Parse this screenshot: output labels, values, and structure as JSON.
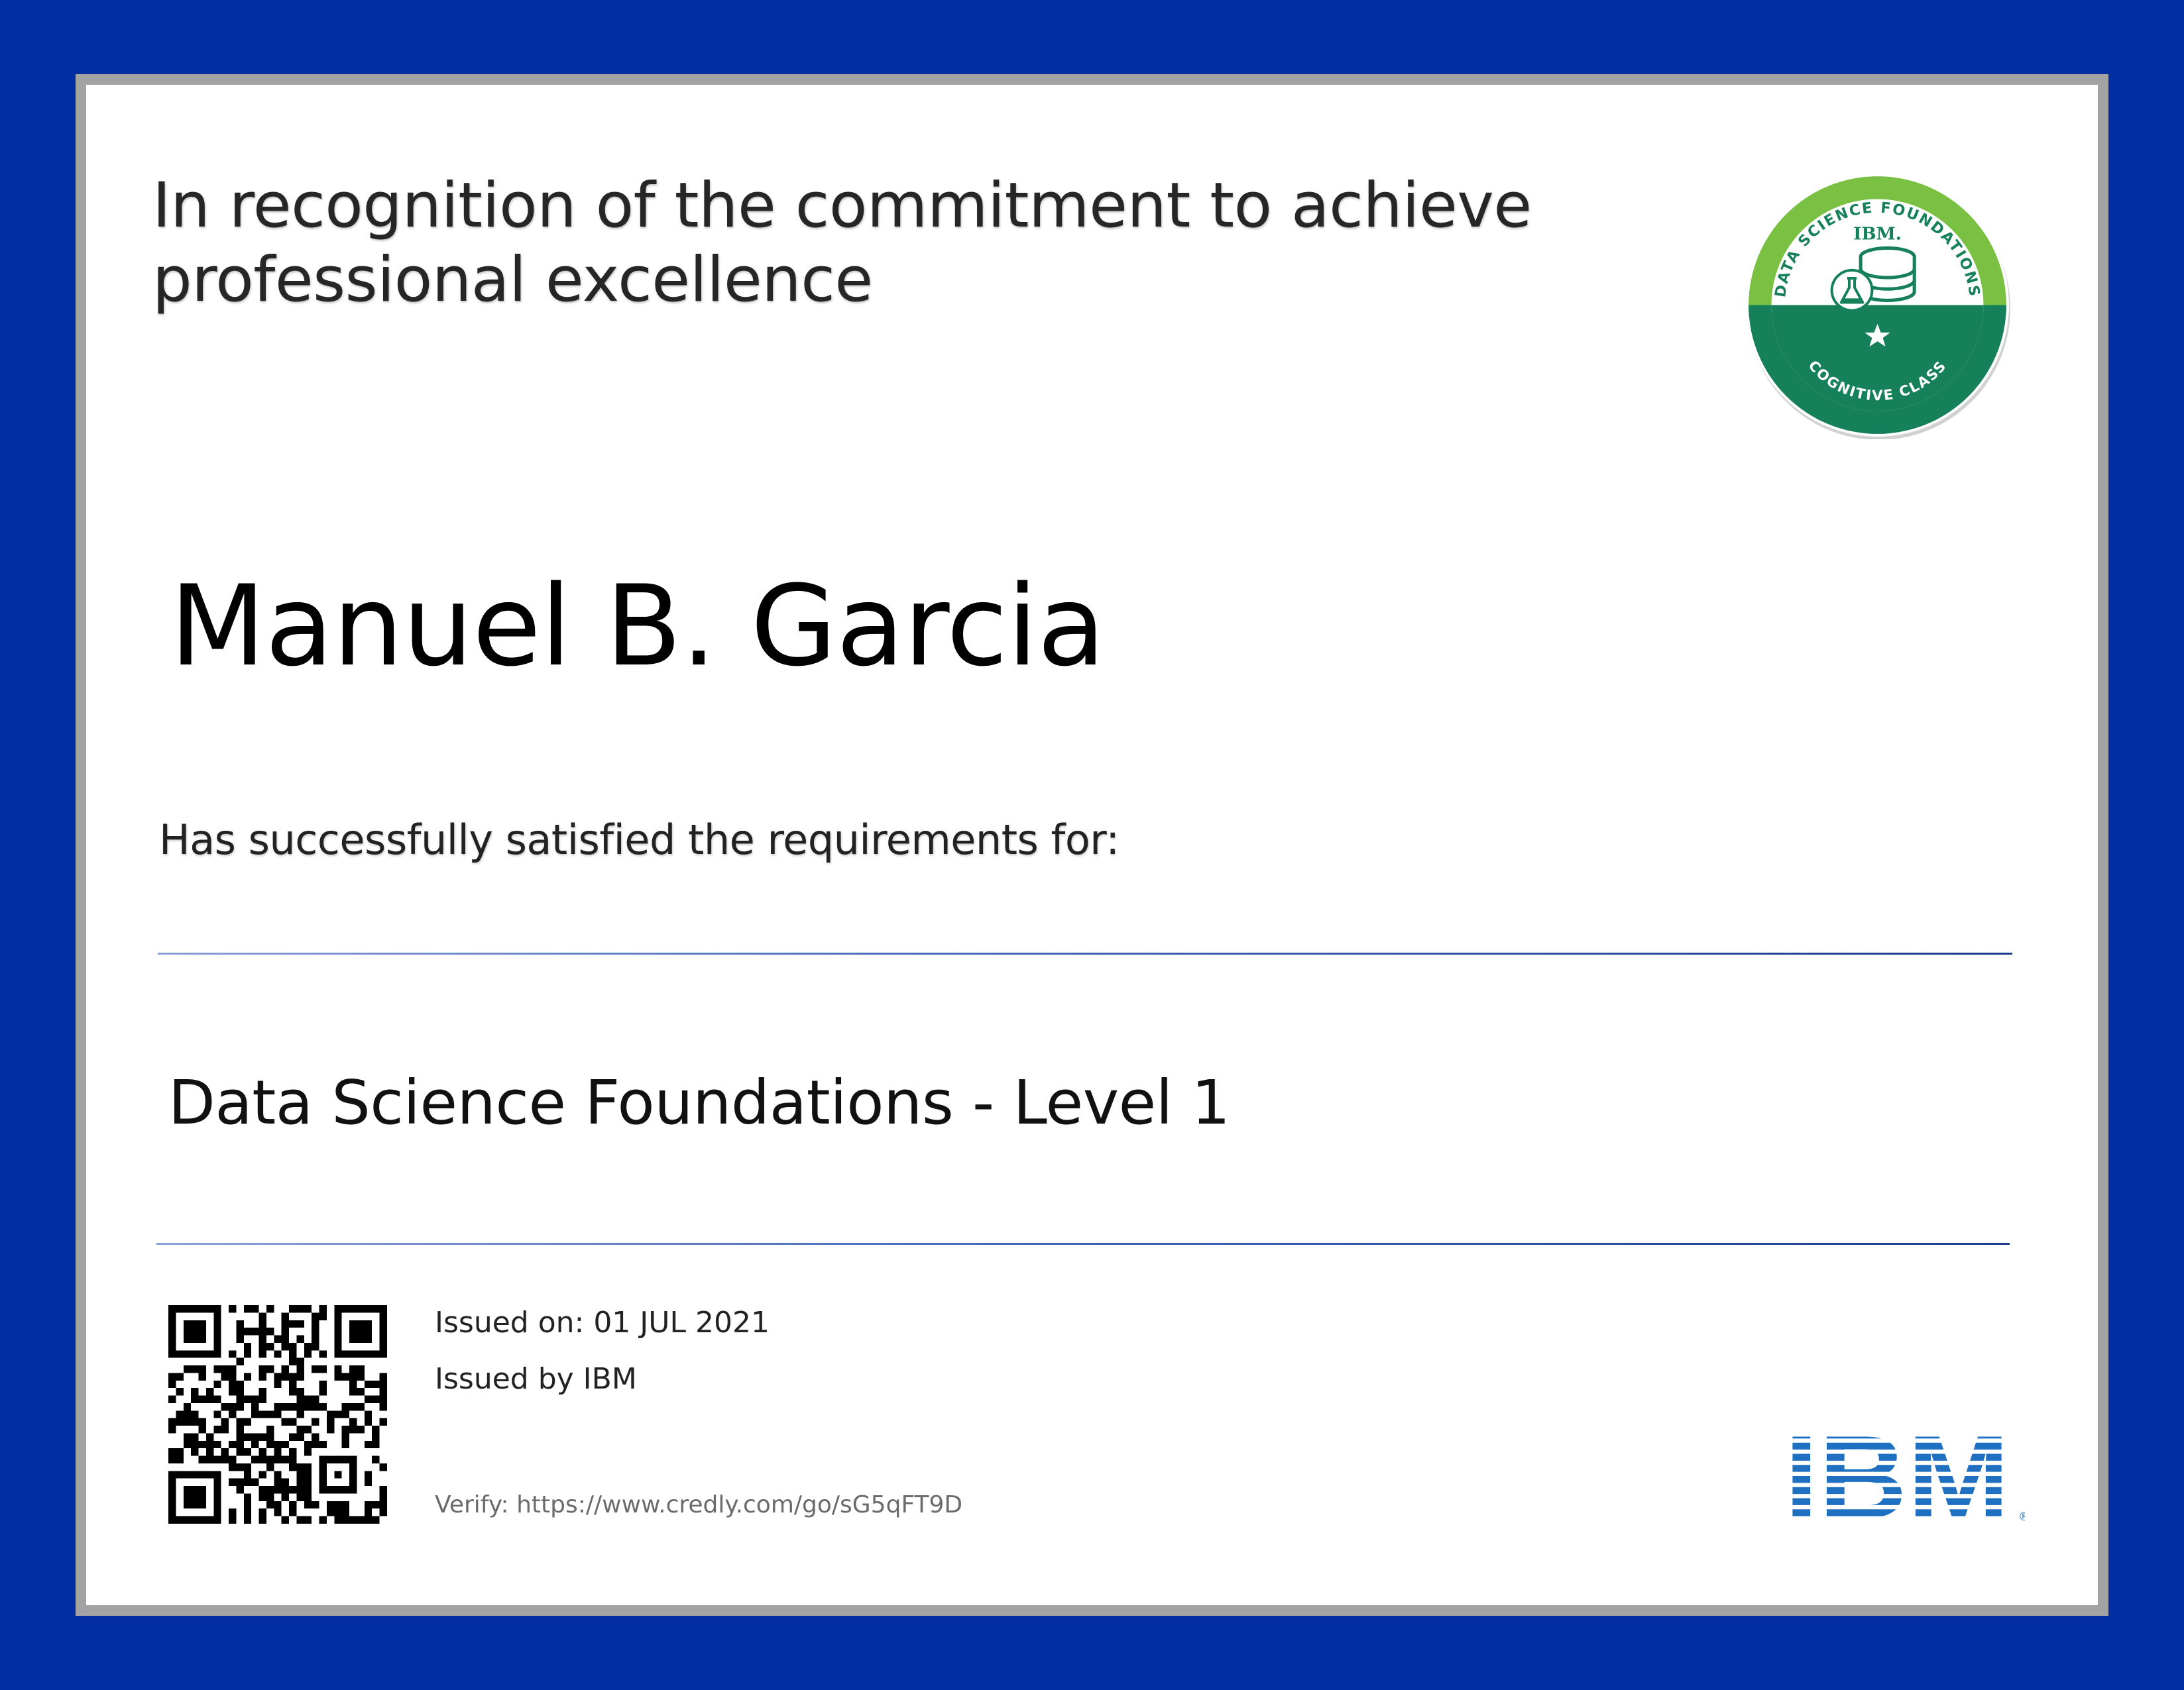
{
  "certificate": {
    "headline": "In recognition of the commitment to achieve professional excellence",
    "recipient_name": "Manuel B. Garcia",
    "requirements_text": "Has successfully satisfied the requirements for:",
    "course_title": "Data Science Foundations - Level 1",
    "issued_on": "Issued on: 01 JUL 2021",
    "issued_by": "Issued by IBM",
    "verify": "Verify: https://www.credly.com/go/sG5qFT9D"
  },
  "badge": {
    "arc_top_text": "DATA SCIENCE FOUNDATIONS",
    "arc_bottom_text": "COGNITIVE CLASS",
    "brand_text": "IBM."
  },
  "logo": {
    "brand_text": "IBM",
    "trademark": "®"
  },
  "colors": {
    "border_blue": "#032ea1",
    "frame_gray": "#a3a3a3",
    "badge_green": "#16805a",
    "badge_light_green": "#7ac143",
    "ibm_blue": "#1f70c1"
  },
  "icons": {
    "qr": "qr-code-icon",
    "badge": "data-science-badge-icon",
    "database": "database-icon",
    "flask": "flask-icon",
    "star": "star-icon"
  }
}
